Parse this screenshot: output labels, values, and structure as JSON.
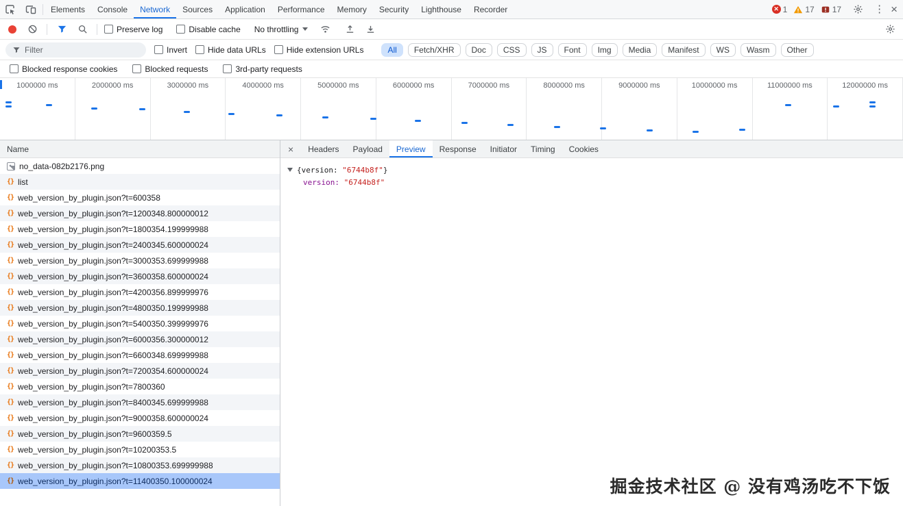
{
  "devtools": {
    "tabs": [
      "Elements",
      "Console",
      "Network",
      "Sources",
      "Application",
      "Performance",
      "Memory",
      "Security",
      "Lighthouse",
      "Recorder"
    ],
    "active_tab": "Network",
    "badges": {
      "errors": "1",
      "warnings": "17",
      "issues": "17"
    }
  },
  "toolbar": {
    "preserve_log": "Preserve log",
    "disable_cache": "Disable cache",
    "throttling": "No throttling"
  },
  "filter_bar": {
    "placeholder": "Filter",
    "invert": "Invert",
    "hide_data_urls": "Hide data URLs",
    "hide_extension_urls": "Hide extension URLs",
    "types": [
      "All",
      "Fetch/XHR",
      "Doc",
      "CSS",
      "JS",
      "Font",
      "Img",
      "Media",
      "Manifest",
      "WS",
      "Wasm",
      "Other"
    ],
    "active_type": "All"
  },
  "options_bar": {
    "blocked_response_cookies": "Blocked response cookies",
    "blocked_requests": "Blocked requests",
    "third_party": "3rd-party requests"
  },
  "timeline": {
    "labels": [
      "1000000 ms",
      "2000000 ms",
      "3000000 ms",
      "4000000 ms",
      "5000000 ms",
      "6000000 ms",
      "7000000 ms",
      "8000000 ms",
      "9000000 ms",
      "10000000 ms",
      "11000000 ms",
      "12000000 ms"
    ],
    "ticks": [
      [
        8,
        34
      ],
      [
        8,
        40
      ],
      [
        67,
        38
      ],
      [
        133,
        43
      ],
      [
        203,
        44
      ],
      [
        268,
        48
      ],
      [
        333,
        51
      ],
      [
        403,
        53
      ],
      [
        470,
        56
      ],
      [
        540,
        58
      ],
      [
        605,
        61
      ],
      [
        673,
        64
      ],
      [
        740,
        67
      ],
      [
        808,
        70
      ],
      [
        875,
        72
      ],
      [
        943,
        75
      ],
      [
        1010,
        77
      ],
      [
        1078,
        74
      ],
      [
        1145,
        38
      ],
      [
        1215,
        40
      ],
      [
        1268,
        34
      ],
      [
        1268,
        40
      ]
    ]
  },
  "requests": {
    "header": "Name",
    "items": [
      {
        "name": "no_data-082b2176.png",
        "icon": "image",
        "selected": false
      },
      {
        "name": "list",
        "icon": "json",
        "selected": false
      },
      {
        "name": "web_version_by_plugin.json?t=600358",
        "icon": "json",
        "selected": false
      },
      {
        "name": "web_version_by_plugin.json?t=1200348.800000012",
        "icon": "json",
        "selected": false
      },
      {
        "name": "web_version_by_plugin.json?t=1800354.199999988",
        "icon": "json",
        "selected": false
      },
      {
        "name": "web_version_by_plugin.json?t=2400345.600000024",
        "icon": "json",
        "selected": false
      },
      {
        "name": "web_version_by_plugin.json?t=3000353.699999988",
        "icon": "json",
        "selected": false
      },
      {
        "name": "web_version_by_plugin.json?t=3600358.600000024",
        "icon": "json",
        "selected": false
      },
      {
        "name": "web_version_by_plugin.json?t=4200356.899999976",
        "icon": "json",
        "selected": false
      },
      {
        "name": "web_version_by_plugin.json?t=4800350.199999988",
        "icon": "json",
        "selected": false
      },
      {
        "name": "web_version_by_plugin.json?t=5400350.399999976",
        "icon": "json",
        "selected": false
      },
      {
        "name": "web_version_by_plugin.json?t=6000356.300000012",
        "icon": "json",
        "selected": false
      },
      {
        "name": "web_version_by_plugin.json?t=6600348.699999988",
        "icon": "json",
        "selected": false
      },
      {
        "name": "web_version_by_plugin.json?t=7200354.600000024",
        "icon": "json",
        "selected": false
      },
      {
        "name": "web_version_by_plugin.json?t=7800360",
        "icon": "json",
        "selected": false
      },
      {
        "name": "web_version_by_plugin.json?t=8400345.699999988",
        "icon": "json",
        "selected": false
      },
      {
        "name": "web_version_by_plugin.json?t=9000358.600000024",
        "icon": "json",
        "selected": false
      },
      {
        "name": "web_version_by_plugin.json?t=9600359.5",
        "icon": "json",
        "selected": false
      },
      {
        "name": "web_version_by_plugin.json?t=10200353.5",
        "icon": "json",
        "selected": false
      },
      {
        "name": "web_version_by_plugin.json?t=10800353.699999988",
        "icon": "json",
        "selected": false
      },
      {
        "name": "web_version_by_plugin.json?t=11400350.100000024",
        "icon": "json",
        "selected": true
      }
    ]
  },
  "details": {
    "tabs": [
      "Headers",
      "Payload",
      "Preview",
      "Response",
      "Initiator",
      "Timing",
      "Cookies"
    ],
    "active_tab": "Preview",
    "preview": {
      "root_prefix": "{version: ",
      "root_value": "\"6744b8f\"",
      "root_suffix": "}",
      "child_key": "version: ",
      "child_value": "\"6744b8f\""
    }
  },
  "watermark": "掘金技术社区 @ 没有鸡汤吃不下饭",
  "colors": {
    "accent": "#1a73e8",
    "selected_row": "#a8c7fa",
    "string": "#c5221f",
    "key": "#881391"
  }
}
